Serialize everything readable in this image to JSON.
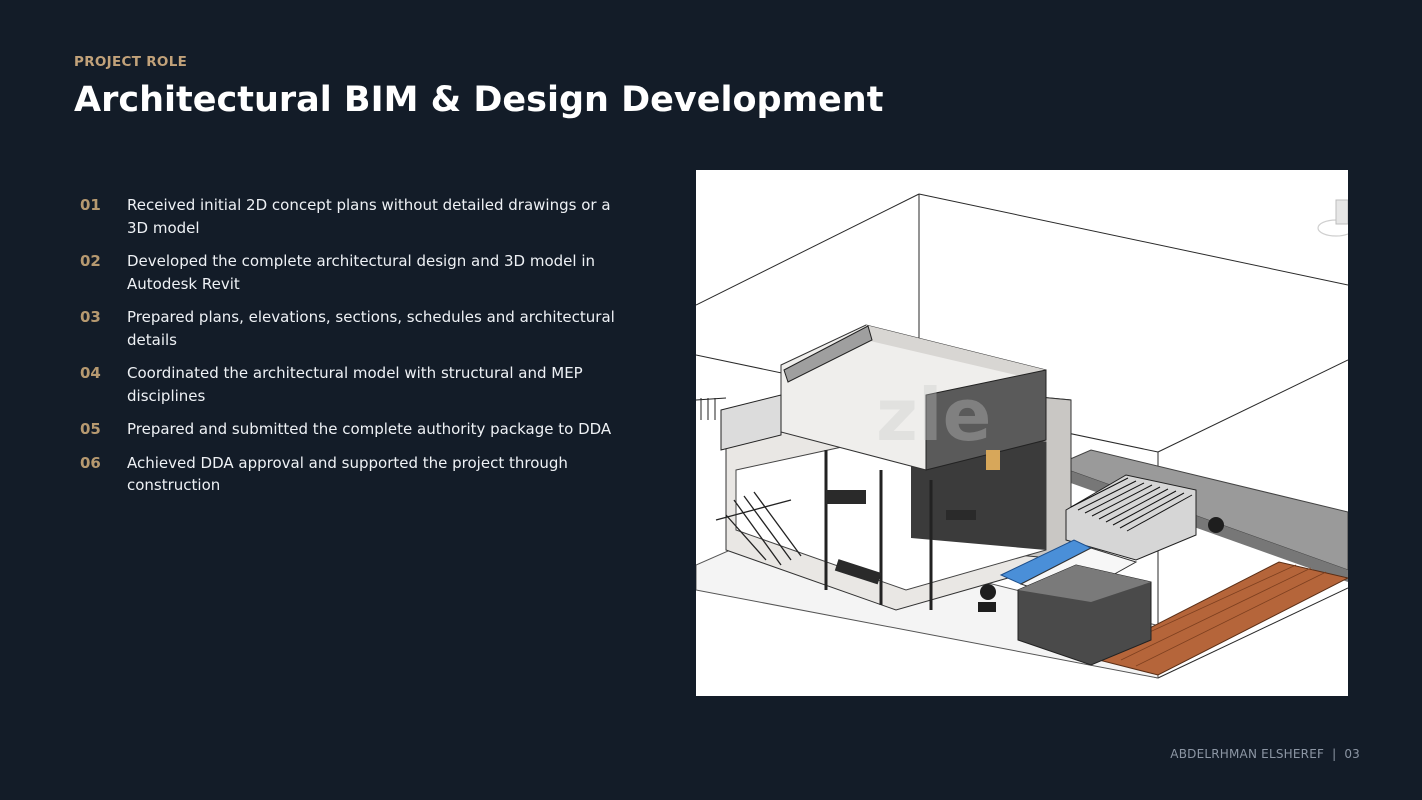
{
  "header": {
    "eyebrow": "PROJECT ROLE",
    "title": "Architectural BIM & Design Development"
  },
  "roles": [
    {
      "num": "01",
      "text": "Received initial 2D concept plans without detailed drawings or a 3D model"
    },
    {
      "num": "02",
      "text": "Developed the complete architectural design and 3D model in Autodesk Revit"
    },
    {
      "num": "03",
      "text": "Prepared plans, elevations, sections, schedules and architectural details"
    },
    {
      "num": "04",
      "text": "Coordinated the architectural model with structural and MEP disciplines"
    },
    {
      "num": "05",
      "text": "Prepared and submitted the complete authority package to DDA"
    },
    {
      "num": "06",
      "text": "Achieved DDA approval and supported the project through construction"
    }
  ],
  "footer": {
    "author": "ABDELRHMAN ELSHEREF",
    "separator": "|",
    "page": "03"
  },
  "colors": {
    "background": "#131c28",
    "accent": "#c2a27a",
    "title": "#ffffff",
    "body_text": "#eef1f5"
  }
}
